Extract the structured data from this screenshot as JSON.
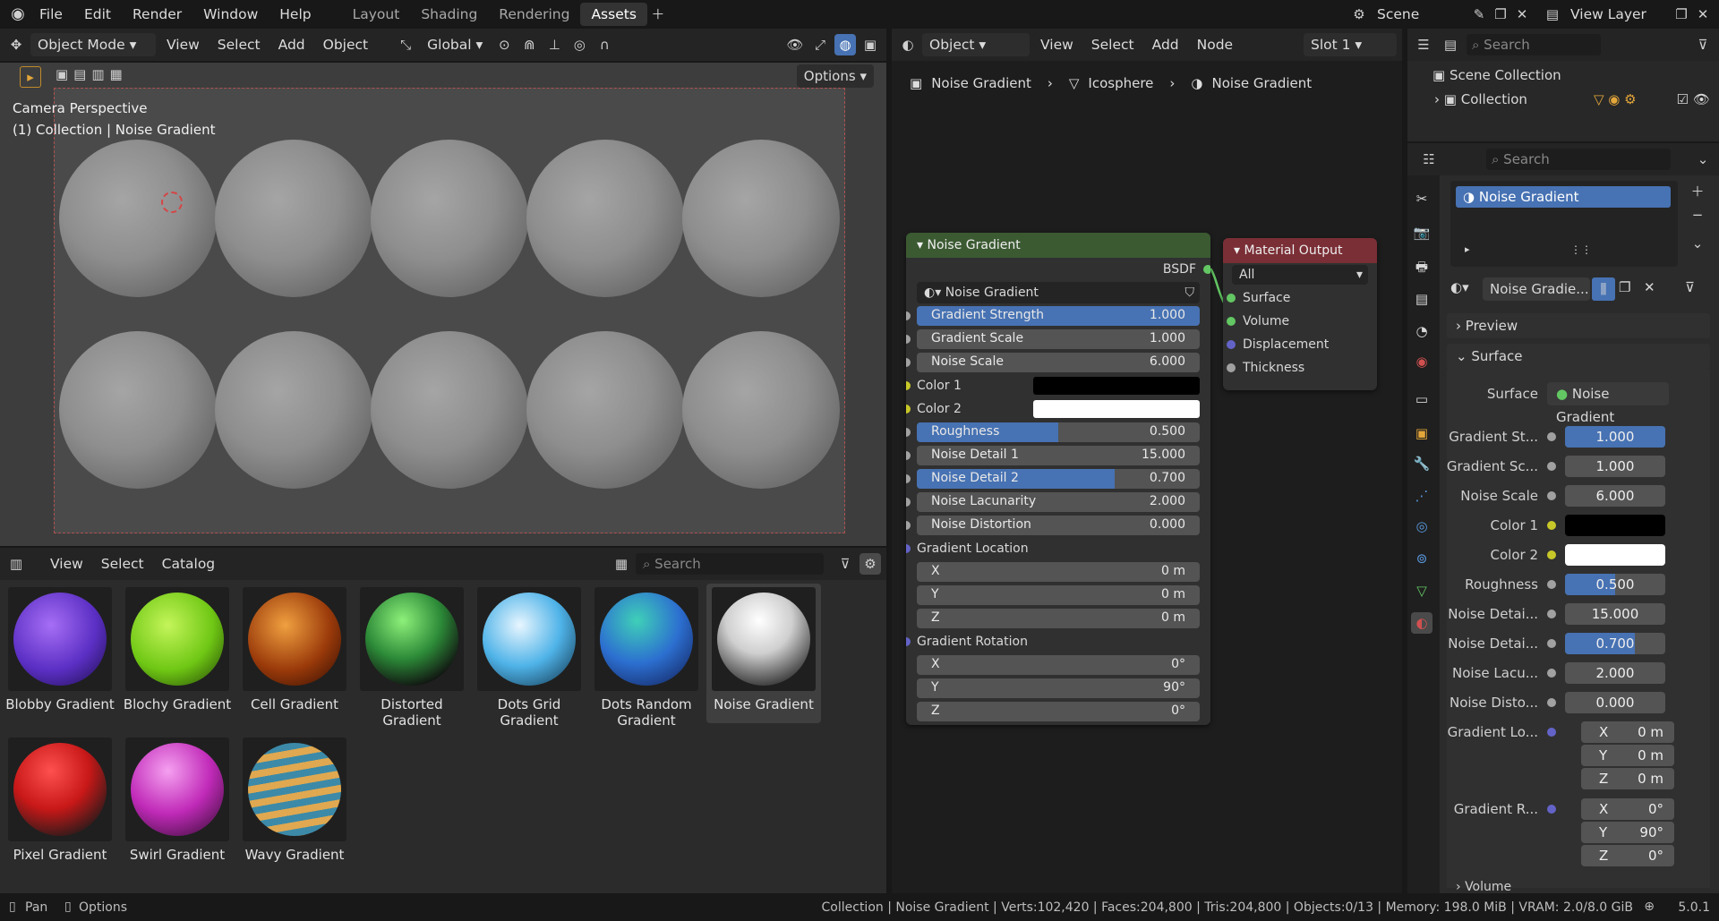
{
  "topbar": {
    "menus": [
      "File",
      "Edit",
      "Render",
      "Window",
      "Help"
    ],
    "workspaces": [
      "Layout",
      "Shading",
      "Rendering",
      "Assets"
    ],
    "active_workspace": "Assets",
    "scene": "Scene",
    "view_layer": "View Layer"
  },
  "viewport": {
    "mode": "Object Mode",
    "menus": [
      "View",
      "Select",
      "Add",
      "Object"
    ],
    "orientation": "Global",
    "options_label": "Options",
    "overlay_title": "Camera Perspective",
    "overlay_subtitle": "(1) Collection | Noise Gradient"
  },
  "asset_browser": {
    "menus": [
      "View",
      "Select",
      "Catalog"
    ],
    "search_placeholder": "Search",
    "assets": [
      {
        "label": "Blobby Gradient",
        "color": "#6a3cd0"
      },
      {
        "label": "Blochy Gradient",
        "color": "#7fd11d"
      },
      {
        "label": "Cell Gradient",
        "color": "#a4440f"
      },
      {
        "label": "Distorted Gradient",
        "color": "#3fa94a"
      },
      {
        "label": "Dots Grid Gradient",
        "color": "#3c9ad6"
      },
      {
        "label": "Dots Random Gradient",
        "color": "#2c6fd0"
      },
      {
        "label": "Noise Gradient",
        "color": "#cfcfcf"
      },
      {
        "label": "Pixel Gradient",
        "color": "#c81818"
      },
      {
        "label": "Swirl Gradient",
        "color": "#c02ab8"
      },
      {
        "label": "Wavy Gradient",
        "color": "#c89a4c"
      }
    ],
    "selected": "Noise Gradient"
  },
  "node_editor": {
    "mode": "Object",
    "menus": [
      "View",
      "Select",
      "Add",
      "Node"
    ],
    "slot": "Slot 1",
    "breadcrumb": [
      "Noise Gradient",
      "Icosphere",
      "Noise Gradient"
    ],
    "group_node": {
      "title": "Noise Gradient",
      "output": "BSDF",
      "datablock": "Noise Gradient",
      "inputs": [
        {
          "label": "Gradient Strength",
          "value": "1.000",
          "fill": 1.0
        },
        {
          "label": "Gradient Scale",
          "value": "1.000",
          "fill": 0
        },
        {
          "label": "Noise Scale",
          "value": "6.000",
          "fill": 0
        }
      ],
      "color1_label": "Color 1",
      "color2_label": "Color 2",
      "inputs2": [
        {
          "label": "Roughness",
          "value": "0.500",
          "fill": 0.5
        },
        {
          "label": "Noise Detail 1",
          "value": "15.000",
          "fill": 0
        },
        {
          "label": "Noise Detail 2",
          "value": "0.700",
          "fill": 0.7
        },
        {
          "label": "Noise Lacunarity",
          "value": "2.000",
          "fill": 0
        },
        {
          "label": "Noise Distortion",
          "value": "0.000",
          "fill": 0
        }
      ],
      "location_label": "Gradient Location",
      "location": [
        {
          "axis": "X",
          "value": "0 m"
        },
        {
          "axis": "Y",
          "value": "0 m"
        },
        {
          "axis": "Z",
          "value": "0 m"
        }
      ],
      "rotation_label": "Gradient Rotation",
      "rotation": [
        {
          "axis": "X",
          "value": "0°"
        },
        {
          "axis": "Y",
          "value": "90°"
        },
        {
          "axis": "Z",
          "value": "0°"
        }
      ]
    },
    "output_node": {
      "title": "Material Output",
      "target": "All",
      "inputs": [
        "Surface",
        "Volume",
        "Displacement",
        "Thickness"
      ]
    }
  },
  "outliner": {
    "search_placeholder": "Search",
    "scene_collection": "Scene Collection",
    "collection": "Collection"
  },
  "properties": {
    "search_placeholder": "Search",
    "material_slot": "Noise Gradient",
    "material_name": "Noise Gradie...",
    "preview_label": "Preview",
    "surface_panel": "Surface",
    "surface_label": "Surface",
    "surface_value": "Noise Gradient",
    "rows": [
      {
        "label": "Gradient St...",
        "value": "1.000",
        "fill": 1.0
      },
      {
        "label": "Gradient Sc...",
        "value": "1.000",
        "fill": 0
      },
      {
        "label": "Noise Scale",
        "value": "6.000",
        "fill": 0
      },
      {
        "label": "Roughness",
        "value": "0.500",
        "fill": 0.5
      },
      {
        "label": "Noise Detai...",
        "value": "15.000",
        "fill": 0
      },
      {
        "label": "Noise Detai...",
        "value": "0.700",
        "fill": 0.7
      },
      {
        "label": "Noise Lacu...",
        "value": "2.000",
        "fill": 0
      },
      {
        "label": "Noise Disto...",
        "value": "0.000",
        "fill": 0
      }
    ],
    "color1_label": "Color 1",
    "color2_label": "Color 2",
    "loc_label": "Gradient Lo...",
    "loc": [
      {
        "axis": "X",
        "value": "0 m"
      },
      {
        "axis": "Y",
        "value": "0 m"
      },
      {
        "axis": "Z",
        "value": "0 m"
      }
    ],
    "rot_label": "Gradient R...",
    "rot": [
      {
        "axis": "X",
        "value": "0°"
      },
      {
        "axis": "Y",
        "value": "90°"
      },
      {
        "axis": "Z",
        "value": "0°"
      }
    ],
    "volume_label": "Volume"
  },
  "statusbar": {
    "pan": "Pan",
    "options": "Options",
    "stats": "Collection | Noise Gradient | Verts:102,420 | Faces:204,800 | Tris:204,800 | Objects:0/13 | Memory: 198.0 MiB | VRAM: 2.0/8.0 GiB",
    "version": "5.0.1"
  },
  "colors": {
    "accent": "#4772b3",
    "node_header_group": "#3b5a32",
    "node_header_output": "#7a2e35",
    "socket_float": "#a1a1a1",
    "socket_color": "#c7c729",
    "socket_vector": "#6363c7",
    "socket_shader": "#63c763"
  }
}
